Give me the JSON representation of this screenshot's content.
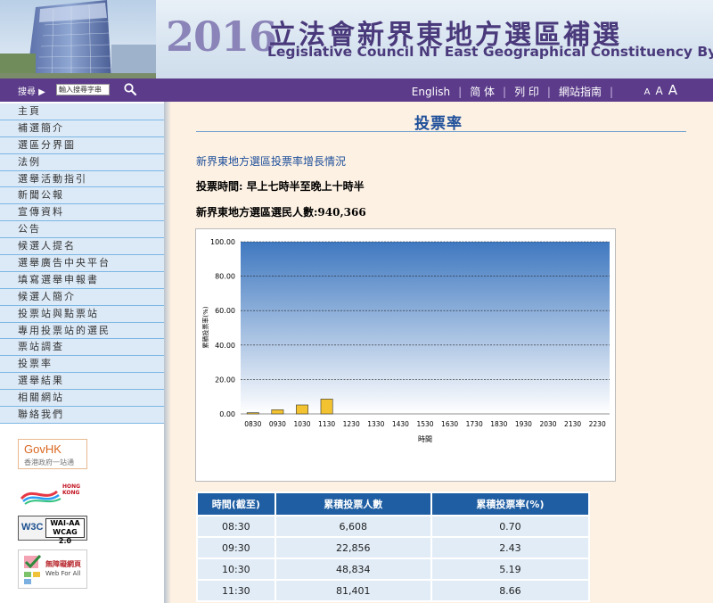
{
  "header": {
    "year": "2016",
    "title_zh": "立法會新界東地方選區補選",
    "title_en": "Legislative Council NT East Geographical Constituency By-election"
  },
  "toolbar": {
    "search_label": "搜尋 ▶",
    "search_placeholder": "輸入搜尋字串",
    "links": [
      "English",
      "简 体",
      "列 印",
      "網站指南"
    ],
    "font_sizes": [
      "A",
      "A",
      "A"
    ]
  },
  "sidebar": {
    "items": [
      "主頁",
      "補選簡介",
      "選區分界圖",
      "法例",
      "選舉活動指引",
      "新聞公報",
      "宣傳資料",
      "公告",
      "候選人提名",
      "選舉廣告中央平台",
      "填寫選舉申報書",
      "候選人簡介",
      "投票站與點票站",
      "專用投票站的選民",
      "票站調查",
      "投票率",
      "選舉結果",
      "相關網站",
      "聯絡我們"
    ],
    "logos": {
      "govhk_main": "GovHK",
      "govhk_sub": "香港政府一站通",
      "brand_hk": "HONG KONG",
      "w3c": "W3C",
      "wcag_line1": "WAI-AA",
      "wcag_line2": "WCAG 2.0",
      "webforall_zh": "無障礙網頁",
      "webforall_en": "Web For All"
    }
  },
  "main": {
    "page_title": "投票率",
    "subtitle": "新界東地方選區投票率增長情況",
    "voting_hours": "投票時間: 早上七時半至晚上十時半",
    "electors": "新界東地方選區選民人數:940,366"
  },
  "chart_data": {
    "type": "bar",
    "ylabel": "累積投票率(%)",
    "xlabel": "時間",
    "ylim": [
      0,
      100
    ],
    "yticks": [
      "0.00",
      "20.00",
      "40.00",
      "60.00",
      "80.00",
      "100.00"
    ],
    "categories": [
      "0830",
      "0930",
      "1030",
      "1130",
      "1230",
      "1330",
      "1430",
      "1530",
      "1630",
      "1730",
      "1830",
      "1930",
      "2030",
      "2130",
      "2230"
    ],
    "values": [
      0.7,
      2.43,
      5.19,
      8.66,
      null,
      null,
      null,
      null,
      null,
      null,
      null,
      null,
      null,
      null,
      null
    ],
    "grid": true,
    "colors": {
      "bar": "#f2c230",
      "plot_top": "#3f78c0",
      "plot_bottom": "#ffffff"
    }
  },
  "table": {
    "headers": [
      "時間(截至)",
      "累積投票人數",
      "累積投票率(%)"
    ],
    "rows": [
      [
        "08:30",
        "6,608",
        "0.70"
      ],
      [
        "09:30",
        "22,856",
        "2.43"
      ],
      [
        "10:30",
        "48,834",
        "5.19"
      ],
      [
        "11:30",
        "81,401",
        "8.66"
      ]
    ]
  }
}
